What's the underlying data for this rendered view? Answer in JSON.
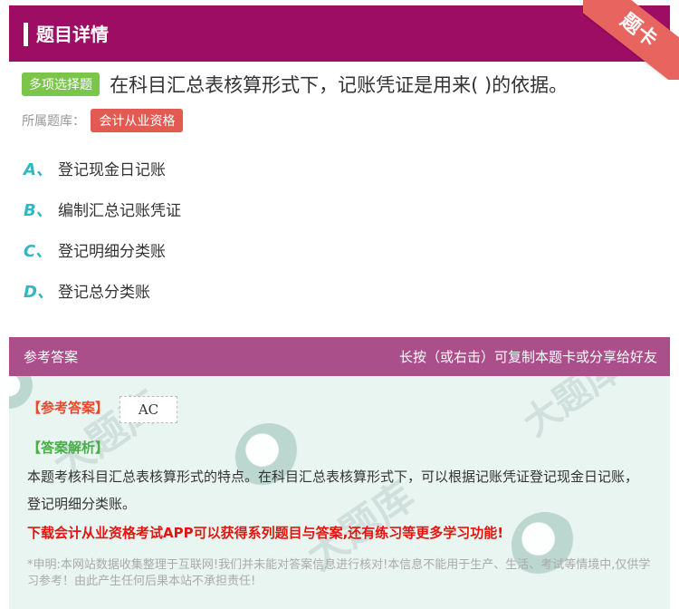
{
  "header": {
    "title": "题目详情"
  },
  "corner": {
    "label": "题卡"
  },
  "question": {
    "type_tag": "多项选择题",
    "text": "在科目汇总表核算形式下，记账凭证是用来( )的依据。",
    "bank_label": "所属题库：",
    "bank_tag": "会计从业资格",
    "options": [
      {
        "letter": "A、",
        "text": "登记现金日记账"
      },
      {
        "letter": "B、",
        "text": "编制汇总记账凭证"
      },
      {
        "letter": "C、",
        "text": "登记明细分类账"
      },
      {
        "letter": "D、",
        "text": "登记总分类账"
      }
    ]
  },
  "answer_bar": {
    "left": "参考答案",
    "right": "长按（或右击）可复制本题卡或分享给好友"
  },
  "answer": {
    "ref_label": "【参考答案】",
    "ref_value": "AC",
    "analysis_label": "【答案解析】",
    "analysis_text": "本题考核科目汇总表核算形式的特点。在科目汇总表核算形式下，可以根据记账凭证登记现金日记账，登记明细分类账。",
    "promo": "下载会计从业资格考试APP可以获得系列题目与答案,还有练习等更多学习功能!",
    "disclaimer": "*申明:本网站数据收集整理于互联网!我们并未能对答案信息进行核对!本信息不能用于生产、生活、考试等情境中,仅供学习参考！由此产生任何后果本站不承担责任!"
  },
  "colors": {
    "header_bg": "#9c0d63",
    "answer_bar_bg": "#ab4f8b",
    "option_letter": "#30b7c2",
    "type_tag_bg": "#7bc54a",
    "bank_tag_bg": "#e25a52",
    "promo": "#e4140f"
  }
}
